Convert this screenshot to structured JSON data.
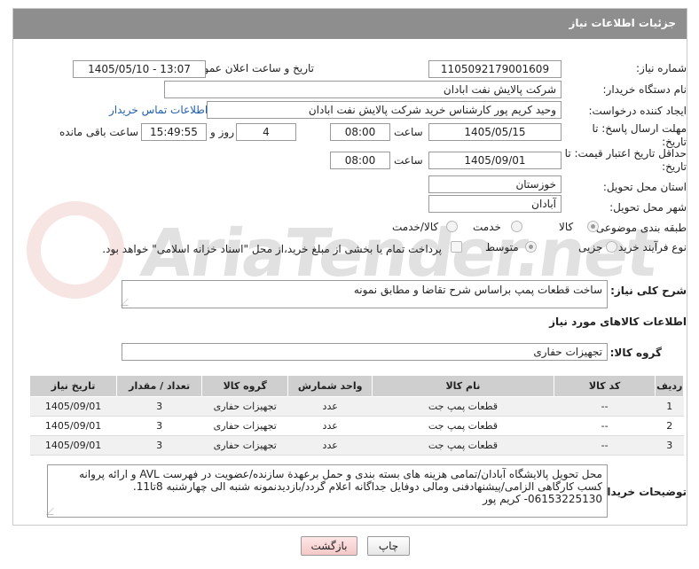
{
  "header": {
    "title": "جزئیات اطلاعات نیاز"
  },
  "fields": {
    "need_number": {
      "label": "شماره نیاز:",
      "value": "1105092179001609"
    },
    "announce_datetime": {
      "label": "تاریخ و ساعت اعلان عمومی:",
      "value": "1405/05/10 - 13:07"
    },
    "buyer_org": {
      "label": "نام دستگاه خریدار:",
      "value": "شرکت پالایش نفت ابادان"
    },
    "requester": {
      "label": "ایجاد کننده درخواست:",
      "value": "وحید کریم پور کارشناس خرید  شرکت پالایش نفت ابادان",
      "contact_link": "اطلاعات تماس خریدار"
    },
    "reply_deadline": {
      "label": "مهلت ارسال پاسخ: تا تاریخ:",
      "date": "1405/05/15",
      "time_label": "ساعت",
      "time": "08:00",
      "days": "4",
      "days_label": "روز و",
      "remaining": "15:49:55",
      "remaining_label": "ساعت باقی مانده"
    },
    "price_validity": {
      "label": "حداقل تاریخ اعتبار قیمت: تا تاریخ:",
      "date": "1405/09/01",
      "time_label": "ساعت",
      "time": "08:00"
    },
    "delivery_province": {
      "label": "استان محل تحویل:",
      "value": "خوزستان"
    },
    "delivery_city": {
      "label": "شهر محل تحویل:",
      "value": "آبادان"
    },
    "category": {
      "label": "طبقه بندی موضوعی:",
      "options": [
        "کالا",
        "خدمت",
        "کالا/خدمت"
      ],
      "selected": "کالا"
    },
    "purchase_type": {
      "label": "نوع فرآیند خرید :",
      "options": [
        "جزیی",
        "متوسط"
      ],
      "selected": "متوسط",
      "payment_note": "پرداخت تمام یا بخشی از مبلغ خرید،از محل \"اسناد خزانه اسلامی\" خواهد بود."
    }
  },
  "description": {
    "label": "شرح کلی نیاز:",
    "value": "ساخت قطعات پمپ براساس شرح تقاضا و مطابق نمونه"
  },
  "goods_section": {
    "title": "اطلاعات کالاهای مورد نیاز",
    "group_label": "گروه کالا:",
    "group_value": "تجهیزات حفاری"
  },
  "table": {
    "columns": [
      "ردیف",
      "کد کالا",
      "نام کالا",
      "واحد شمارش",
      "گروه کالا",
      "تعداد / مقدار",
      "تاریخ نیاز"
    ],
    "rows": [
      [
        "1",
        "--",
        "قطعات پمپ جت",
        "عدد",
        "تجهیزات حفاری",
        "3",
        "1405/09/01"
      ],
      [
        "2",
        "--",
        "قطعات پمپ جت",
        "عدد",
        "تجهیزات حفاری",
        "3",
        "1405/09/01"
      ],
      [
        "3",
        "--",
        "قطعات پمپ جت",
        "عدد",
        "تجهیزات حفاری",
        "3",
        "1405/09/01"
      ]
    ]
  },
  "buyer_notes": {
    "label": "توضیحات خریدار:",
    "lines": [
      "محل تحویل پالایشگاه آبادان/تمامی هزینه های بسته بندی و حمل برعهدة سازنده/عضویت در فهرست AVL و ارائه پروانه",
      "کسب کارگاهی الزامی/پیشنهادفنی ومالی دوفایل جداگانه اعلام گردد/بازدیدنمونه شنبه الی چهارشنبه 8تا11.",
      "06153225130- کریم پور"
    ]
  },
  "buttons": {
    "print": "چاپ",
    "back": "بازگشت"
  },
  "watermark": {
    "text": "AriaTender.net"
  },
  "colors": {
    "header_bg": "#8e8e8e",
    "link": "#1f5fae",
    "back_button": "#f4c8c8",
    "table_header": "#cfcfcf"
  }
}
